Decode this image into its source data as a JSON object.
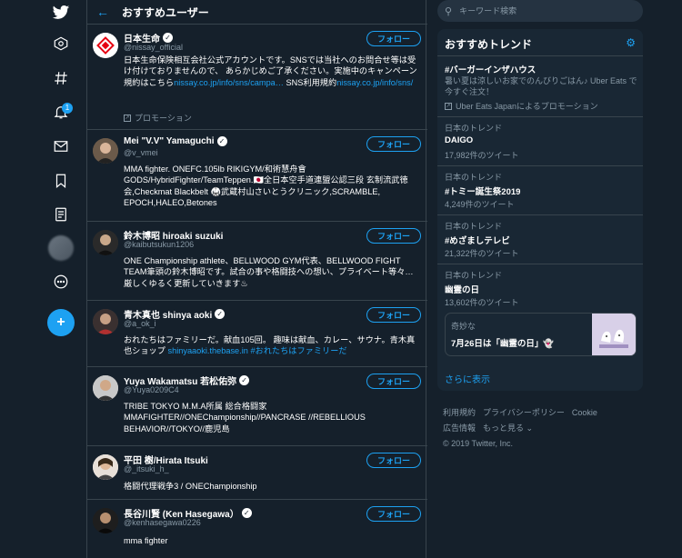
{
  "header": {
    "back_icon": "←",
    "title": "おすすめユーザー"
  },
  "nav": {
    "notification_count": "1",
    "compose_icon": "+"
  },
  "users": [
    {
      "name": "日本生命",
      "handle": "@nissay_official",
      "follow_label": "フォロー",
      "bio_text_1": "日本生命保険相互会社公式アカウントです。SNSでは当社へのお問合せ等は受け付けておりませんので、 あらかじめご了承ください。実施中のキャンペーン規約はこちら",
      "bio_link_1": "nissay.co.jp/info/sns/campa…",
      "bio_text_2": " SNS利用規約",
      "bio_link_2": "nissay.co.jp/info/sns/",
      "promo": "プロモーション"
    },
    {
      "name": "Mei \"V.V\" Yamaguchi",
      "handle": "@v_vmei",
      "follow_label": "フォロー",
      "bio": "MMA fighter. ONEFC.105lb RIKIGYM/和術慧舟會GODS/HybridFighter/TeamTeppen.🇯🇵全日本空手道連盟公認三段 玄制流武徳会,Checkmat Blackbelt 🥋武蔵村山さいとうクリニック,SCRAMBLE, EPOCH,HALEO,Betones"
    },
    {
      "name": "鈴木博昭 hiroaki suzuki",
      "handle": "@kaibutsukun1206",
      "follow_label": "フォロー",
      "bio": "ONE Championship athlete、BELLWOOD GYM代表、BELLWOOD FIGHT TEAM筆頭の鈴木博昭です。試合の事や格闘技への想い、プライベート等々…厳しくゆるく更新していきます♨"
    },
    {
      "name": "青木真也 shinya aoki",
      "handle": "@a_ok_i",
      "follow_label": "フォロー",
      "bio_text_1": "おれたちはファミリーだ。献血105回。 趣味は献血、カレー、サウナ。青木真也ショップ ",
      "bio_link_1": "shinyaaoki.thebase.in",
      "bio_text_2": " ",
      "bio_link_2": "#おれたちはファミリーだ"
    },
    {
      "name": "Yuya Wakamatsu 若松佑弥",
      "handle": "@Yuya0209C4",
      "follow_label": "フォロー",
      "bio": "TRIBE TOKYO M.M.A所属 総合格闘家 MMAFIGHTER//ONEChampionship//PANCRASE //REBELLIOUS BEHAVIOR//TOKYO//鹿児島"
    },
    {
      "name": "平田 樹/Hirata Itsuki",
      "handle": "@_itsuki_h_",
      "follow_label": "フォロー",
      "bio": "格闘代理戦争3 / ONEChampionship"
    },
    {
      "name": "長谷川賢 (Ken Hasegawa）",
      "handle": "@kenhasegawa0226",
      "follow_label": "フォロー",
      "bio": "mma fighter"
    }
  ],
  "search": {
    "placeholder": "キーワード検索"
  },
  "trends": {
    "title": "おすすめトレンド",
    "items": [
      {
        "name": "#バーガーインザハウス",
        "desc": "暑い夏は涼しいお家でのんびりごはん♪ Uber Eats で今すぐ注文！",
        "promo": "Uber Eats Japanによるプロモーション"
      },
      {
        "meta": "日本のトレンド",
        "name": "DAIGO",
        "count": "17,982件のツイート"
      },
      {
        "meta": "日本のトレンド",
        "name": "#トミー誕生祭2019",
        "count": "4,249件のツイート"
      },
      {
        "meta": "日本のトレンド",
        "name": "#めざましテレビ",
        "count": "21,322件のツイート"
      },
      {
        "meta": "日本のトレンド",
        "name": "幽霊の日",
        "count": "13,602件のツイート"
      }
    ],
    "moment": {
      "category": "奇妙な",
      "title": "7月26日は「幽霊の日」👻"
    },
    "show_more": "さらに表示"
  },
  "footer": {
    "terms": "利用規約",
    "privacy": "プライバシーポリシー",
    "cookie": "Cookie",
    "ads": "広告情報",
    "more": "もっと見る ⌄",
    "copyright": "© 2019 Twitter, Inc."
  }
}
